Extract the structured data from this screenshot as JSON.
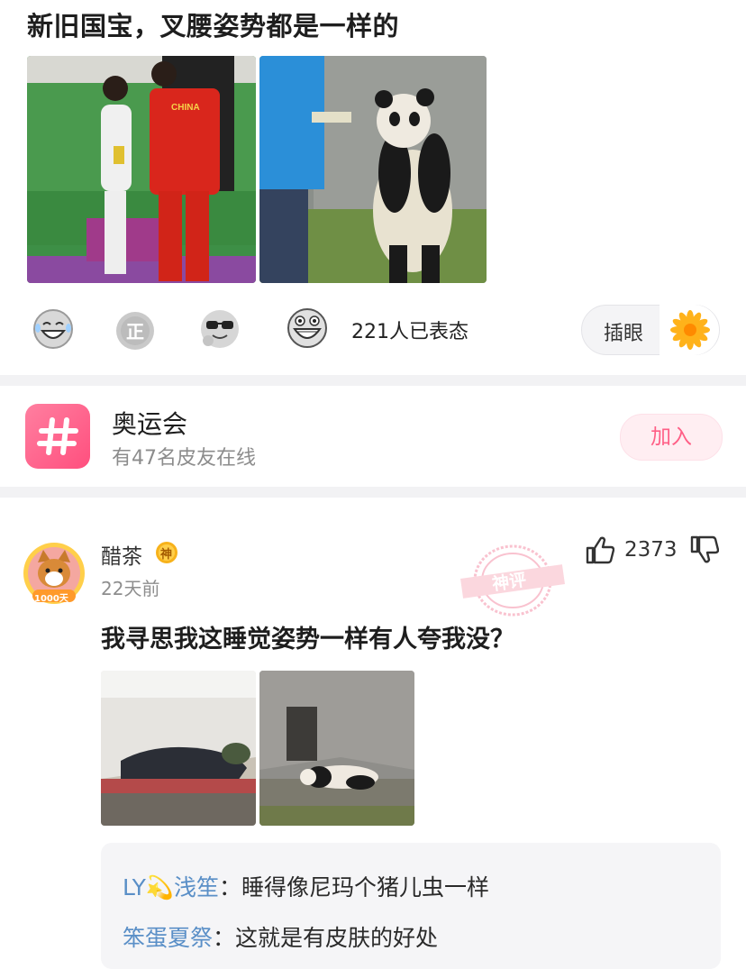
{
  "post": {
    "title": "新旧国宝，叉腰姿势都是一样的",
    "images": [
      {
        "name": "athlete-photo",
        "jersey_text": "CHINA"
      },
      {
        "name": "panda-standing-photo"
      }
    ],
    "reactions": {
      "icons": [
        "laughing-face-icon",
        "zheng-badge-icon",
        "sunglasses-face-icon",
        "grinning-face-icon"
      ],
      "count_text": "221人已表态"
    },
    "chabi_label": "插眼"
  },
  "topic": {
    "name": "奥运会",
    "subtitle": "有47名皮友在线",
    "join_label": "加入",
    "icon_symbol": "#"
  },
  "comment": {
    "user_name": "醋茶",
    "user_badge": "神",
    "avatar_badge": "1000天",
    "time": "22天前",
    "like_count": "2373",
    "stamp_text": "神评",
    "text": "我寻思我这睡觉姿势一样有人夸我没？",
    "images": [
      {
        "name": "person-sleeping-photo"
      },
      {
        "name": "panda-lying-photo"
      }
    ],
    "replies": [
      {
        "user": "LY💫浅笙",
        "text": "：睡得像尼玛个猪儿虫一样"
      },
      {
        "user": "笨蛋夏祭",
        "text": "：这就是有皮肤的好处"
      }
    ]
  },
  "colors": {
    "accent_pink": "#ff5f86",
    "reply_user_blue": "#5a8fc7",
    "separator": "#f2f2f4"
  }
}
